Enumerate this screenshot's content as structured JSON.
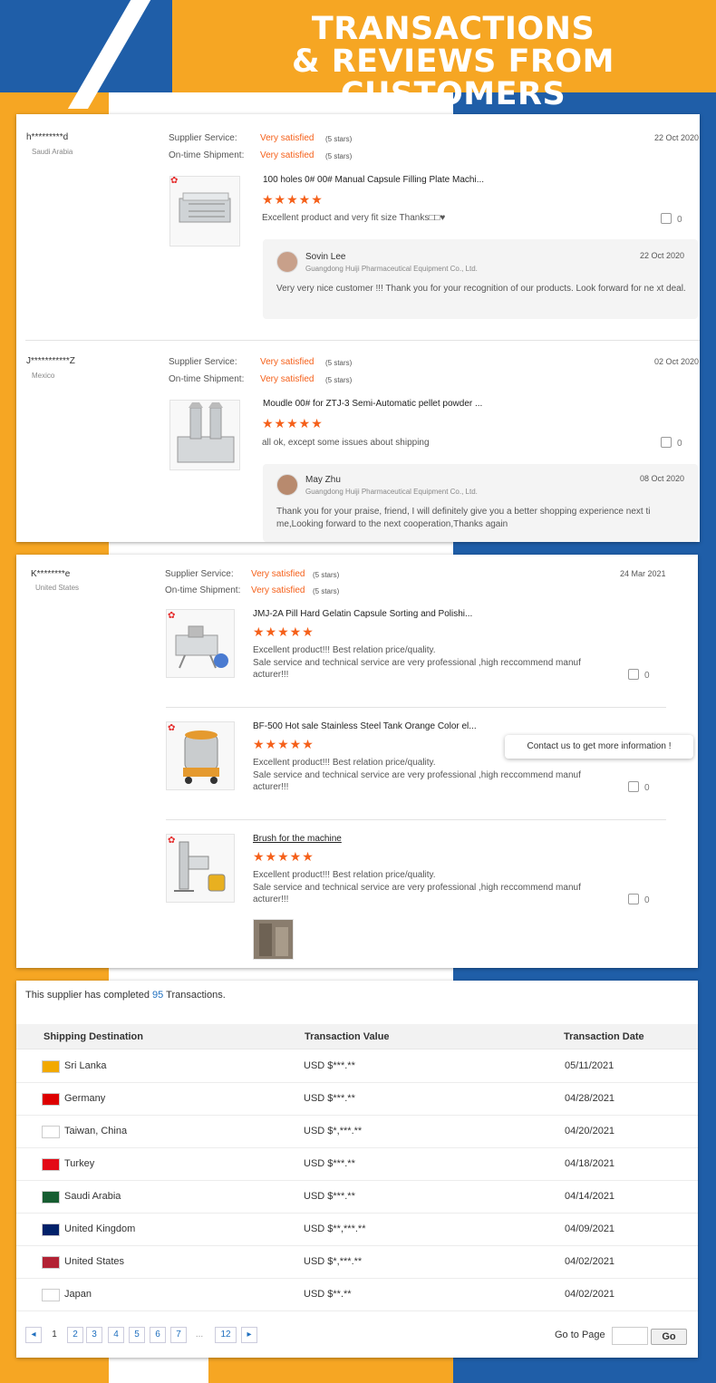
{
  "header": {
    "line1": "TRANSACTIONS",
    "line2": "& REVIEWS FROM CUSTOMERS"
  },
  "reviews": [
    {
      "user": "h*********d",
      "country": "Saudi Arabia",
      "supplier_service_label": "Supplier Service:",
      "supplier_service_value": "Very satisfied",
      "supplier_service_stars": "(5 stars)",
      "shipment_label": "On-time Shipment:",
      "shipment_value": "Very satisfied",
      "shipment_stars": "(5 stars)",
      "date": "22 Oct 2020",
      "product_title": "100 holes 0# 00# Manual Capsule Filling Plate Machi...",
      "comment": "Excellent product and very fit size Thanks□□♥",
      "likes": "0",
      "reply": {
        "name": "Sovin Lee",
        "company": "Guangdong Huiji Pharmaceutical Equipment Co., Ltd.",
        "date": "22 Oct 2020",
        "text": "Very very nice customer !!! Thank you for your recognition of our products. Look forward for ne xt deal."
      }
    },
    {
      "user": "J***********Z",
      "country": "Mexico",
      "supplier_service_label": "Supplier Service:",
      "supplier_service_value": "Very satisfied",
      "supplier_service_stars": "(5 stars)",
      "shipment_label": "On-time Shipment:",
      "shipment_value": "Very satisfied",
      "shipment_stars": "(5 stars)",
      "date": "02 Oct 2020",
      "product_title": "Moudle 00# for ZTJ-3 Semi-Automatic pellet powder ...",
      "comment": "all ok, except some issues about shipping",
      "likes": "0",
      "reply": {
        "name": "May Zhu",
        "company": "Guangdong Huiji Pharmaceutical Equipment Co., Ltd.",
        "date": "08 Oct 2020",
        "text": "Thank you for your praise, friend, I will definitely give you a better shopping experience next ti me,Looking forward to the next cooperation,Thanks again"
      }
    },
    {
      "user": "K********e",
      "country": "United States",
      "supplier_service_label": "Supplier Service:",
      "supplier_service_value": "Very satisfied",
      "supplier_service_stars": "(5 stars)",
      "shipment_label": "On-time Shipment:",
      "shipment_value": "Very satisfied",
      "shipment_stars": "(5 stars)",
      "date": "24 Mar 2021",
      "items": [
        {
          "product_title": "JMJ-2A Pill Hard Gelatin Capsule Sorting and Polishi...",
          "comment_line1": "Excellent product!!! Best relation price/quality.",
          "comment_line2": "Sale service and technical service are very professional ,high reccommend manuf",
          "comment_line3": "acturer!!!",
          "likes": "0"
        },
        {
          "product_title": "BF-500 Hot sale Stainless Steel Tank Orange Color el...",
          "comment_line1": "Excellent product!!! Best relation price/quality.",
          "comment_line2": "Sale service and technical service are very professional ,high reccommend manuf",
          "comment_line3": "acturer!!!",
          "likes": "0"
        },
        {
          "product_title": "Brush for the machine",
          "comment_line1": "Excellent product!!! Best relation price/quality.",
          "comment_line2": "Sale service and technical service are very professional ,high reccommend manuf",
          "comment_line3": "acturer!!!",
          "likes": "0"
        }
      ]
    }
  ],
  "stars_glyph": "★★★★★",
  "contact_bubble": "Contact us to get more information !",
  "transactions": {
    "summary_prefix": "This supplier has completed",
    "count": "95",
    "summary_suffix": "Transactions.",
    "columns": [
      "Shipping Destination",
      "Transaction Value",
      "Transaction Date"
    ],
    "rows": [
      {
        "destination": "Sri Lanka",
        "value": "USD $***.**",
        "date": "05/11/2021",
        "flag_color": "#f2a900"
      },
      {
        "destination": "Germany",
        "value": "USD $***.**",
        "date": "04/28/2021",
        "flag_color": "#dd0000"
      },
      {
        "destination": "Taiwan, China",
        "value": "USD $*,***.**",
        "date": "04/20/2021",
        "flag_color": "#ffffff"
      },
      {
        "destination": "Turkey",
        "value": "USD $***.**",
        "date": "04/18/2021",
        "flag_color": "#e30a17"
      },
      {
        "destination": "Saudi Arabia",
        "value": "USD $***.**",
        "date": "04/14/2021",
        "flag_color": "#165d31"
      },
      {
        "destination": "United Kingdom",
        "value": "USD $**,***.**",
        "date": "04/09/2021",
        "flag_color": "#012169"
      },
      {
        "destination": "United States",
        "value": "USD $*,***.**",
        "date": "04/02/2021",
        "flag_color": "#b22234"
      },
      {
        "destination": "Japan",
        "value": "USD $**.**",
        "date": "04/02/2021",
        "flag_color": "#ffffff"
      }
    ]
  },
  "pagination": {
    "prev": "◂",
    "pages": [
      "1",
      "2",
      "3",
      "4",
      "5",
      "6",
      "7",
      "...",
      "12"
    ],
    "next": "▸",
    "goto_label": "Go to Page",
    "go_button": "Go"
  },
  "colors": {
    "orange": "#f6a623",
    "blue": "#1f5ea8",
    "rating": "#f5601a",
    "link": "#1f6fbf"
  }
}
